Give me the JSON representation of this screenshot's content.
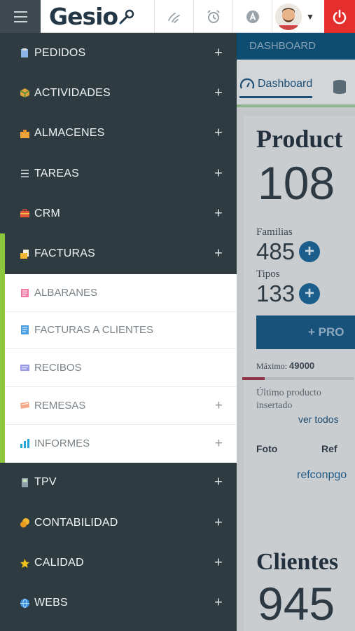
{
  "topbar": {
    "logo": "Gesio",
    "icons": [
      "handshake-icon",
      "alarm-clock-icon",
      "a-badge-icon",
      "avatar",
      "chevron-down-icon",
      "power-icon"
    ]
  },
  "menu": {
    "items": [
      {
        "label": "PEDIDOS",
        "icon": "clipboard-icon",
        "plus": "+"
      },
      {
        "label": "ACTIVIDADES",
        "icon": "cube-icon",
        "plus": "+"
      },
      {
        "label": "ALMACENES",
        "icon": "warehouse-icon",
        "plus": "+"
      },
      {
        "label": "TAREAS",
        "icon": "list-icon",
        "plus": "+"
      },
      {
        "label": "CRM",
        "icon": "briefcase-icon",
        "plus": "+"
      },
      {
        "label": "FACTURAS",
        "icon": "invoice-icon",
        "plus": "+"
      }
    ],
    "submenu": [
      {
        "label": "ALBARANES",
        "icon": "document-pink-icon"
      },
      {
        "label": "FACTURAS A CLIENTES",
        "icon": "document-blue-icon"
      },
      {
        "label": "RECIBOS",
        "icon": "receipt-icon"
      },
      {
        "label": "REMESAS",
        "icon": "remittance-icon",
        "plus": "+"
      },
      {
        "label": "INFORMES",
        "icon": "bar-chart-icon",
        "plus": "+"
      }
    ],
    "items_after": [
      {
        "label": "TPV",
        "icon": "pos-terminal-icon",
        "plus": "+"
      },
      {
        "label": "CONTABILIDAD",
        "icon": "coins-icon",
        "plus": "+"
      },
      {
        "label": "CALIDAD",
        "icon": "star-icon",
        "plus": "+"
      },
      {
        "label": "WEBS",
        "icon": "globe-icon",
        "plus": "+"
      }
    ]
  },
  "dashboard": {
    "header": "DASHBOARD",
    "tab_label": "Dashboard",
    "card1_title": "Product",
    "card1_value": "108",
    "familias_label": "Familias",
    "familias_value": "485",
    "tipos_label": "Tipos",
    "tipos_value": "133",
    "add_button": "+ PRO",
    "maximo_label": "Máximo:",
    "maximo_value": "49000",
    "progress": 0.2,
    "ultimo_label": "Último producto insertado",
    "ver_todos": "ver todos",
    "col_foto": "Foto",
    "col_ref": "Ref",
    "ref_value": "refconpgo",
    "card2_title": "Clientes",
    "card2_value": "945",
    "plus_sign": "+"
  }
}
